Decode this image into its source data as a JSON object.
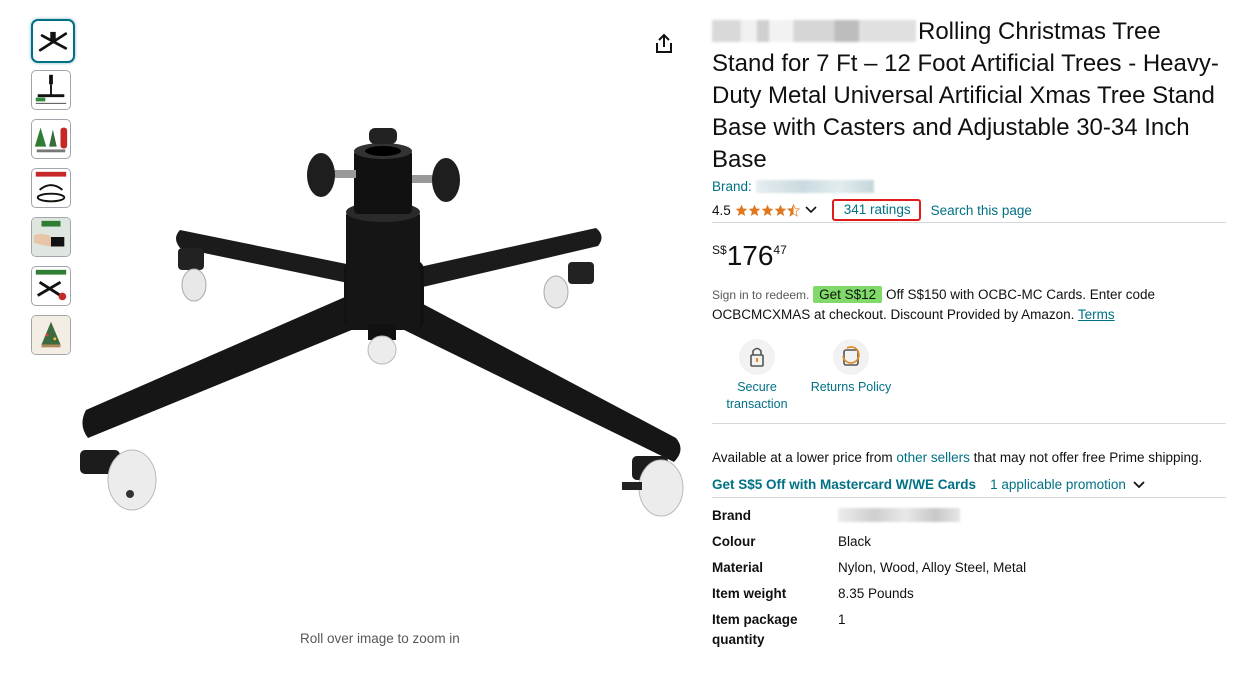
{
  "thumbnails": [
    {
      "icon": "stand-top-view"
    },
    {
      "icon": "stand-dimension-diagram"
    },
    {
      "icon": "trees-comparison"
    },
    {
      "icon": "stand-parts-diagram"
    },
    {
      "icon": "hand-installation"
    },
    {
      "icon": "stand-features"
    },
    {
      "icon": "decorated-tree"
    }
  ],
  "image": {
    "zoom_hint": "Roll over image to zoom in"
  },
  "product": {
    "title": "Rolling Christmas Tree Stand for 7 Ft – 12 Foot Artificial Trees - Heavy-Duty Metal Universal Artificial Xmas Tree Stand Base with Casters and Adjustable 30-34 Inch Base",
    "brand_label": "Brand:",
    "rating": "4.5",
    "ratings_count": "341 ratings",
    "search_page": "Search this page",
    "price": {
      "currency": "S$",
      "whole": "176",
      "fraction": "47"
    }
  },
  "promo": {
    "signin": "Sign in to redeem.",
    "badge": "Get S$12",
    "text": " Off S$150 with OCBC-MC Cards. Enter code OCBCMCXMAS at checkout. Discount Provided by Amazon.",
    "terms": "Terms"
  },
  "features": [
    {
      "icon": "lock-icon",
      "label": "Secure transaction"
    },
    {
      "icon": "return-icon",
      "label": "Returns Policy"
    }
  ],
  "availability": {
    "before": "Available at a lower price from ",
    "link": "other sellers",
    "after": " that may not offer free Prime shipping."
  },
  "promo2": {
    "offer": "Get S$5 Off with Mastercard W/WE Cards",
    "applicable": "1 applicable promotion"
  },
  "specs": [
    {
      "key": "Brand",
      "value": ""
    },
    {
      "key": "Colour",
      "value": "Black"
    },
    {
      "key": "Material",
      "value": "Nylon, Wood, Alloy Steel, Metal"
    },
    {
      "key": "Item weight",
      "value": "8.35 Pounds"
    },
    {
      "key": "Item package quantity",
      "value": "1"
    }
  ],
  "colors": {
    "link": "#007185",
    "star": "#de7921",
    "badge": "#7fda69",
    "highlight_box": "#e01b1b"
  }
}
